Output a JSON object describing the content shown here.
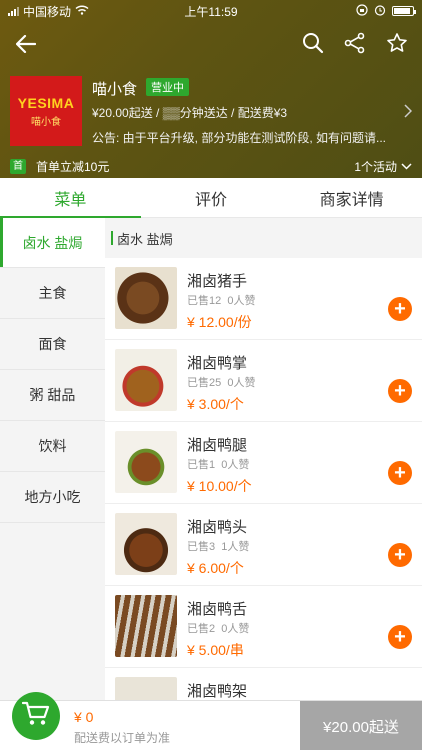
{
  "status_bar": {
    "carrier": "中国移动",
    "time": "上午11:59"
  },
  "shop": {
    "logo_text": "YESIMA",
    "logo_sub": "喵小食",
    "name": "喵小食",
    "open_badge": "营业中",
    "info": "¥20.00起送 / ▒▒分钟送达 / 配送费¥3",
    "notice": "公告: 由于平台升级, 部分功能在测试阶段, 如有问题请..."
  },
  "promo": {
    "first_badge": "首",
    "text": "首单立减10元",
    "activities": "1个活动"
  },
  "tabs": [
    "菜单",
    "评价",
    "商家详情"
  ],
  "sidebar": [
    "卤水 盐焗",
    "主食",
    "面食",
    "粥 甜品",
    "饮料",
    "地方小吃"
  ],
  "category_title": "卤水 盐焗",
  "items": [
    {
      "name": "湘卤猪手",
      "sold": "已售12",
      "likes": "0人赞",
      "price": "¥ 12.00/份"
    },
    {
      "name": "湘卤鸭掌",
      "sold": "已售25",
      "likes": "0人赞",
      "price": "¥ 3.00/个"
    },
    {
      "name": "湘卤鸭腿",
      "sold": "已售1",
      "likes": "0人赞",
      "price": "¥ 10.00/个"
    },
    {
      "name": "湘卤鸭头",
      "sold": "已售3",
      "likes": "1人赞",
      "price": "¥ 6.00/个"
    },
    {
      "name": "湘卤鸭舌",
      "sold": "已售2",
      "likes": "0人赞",
      "price": "¥ 5.00/串"
    },
    {
      "name": "湘卤鸭架",
      "sold": "",
      "likes": "",
      "price": ""
    }
  ],
  "bottom": {
    "total": "¥ 0",
    "fee_note": "配送费以订单为准",
    "checkout": "¥20.00起送"
  },
  "colors": {
    "accent": "#2ea82e",
    "price": "#ff6a00",
    "header_bg": "#5e5412"
  }
}
